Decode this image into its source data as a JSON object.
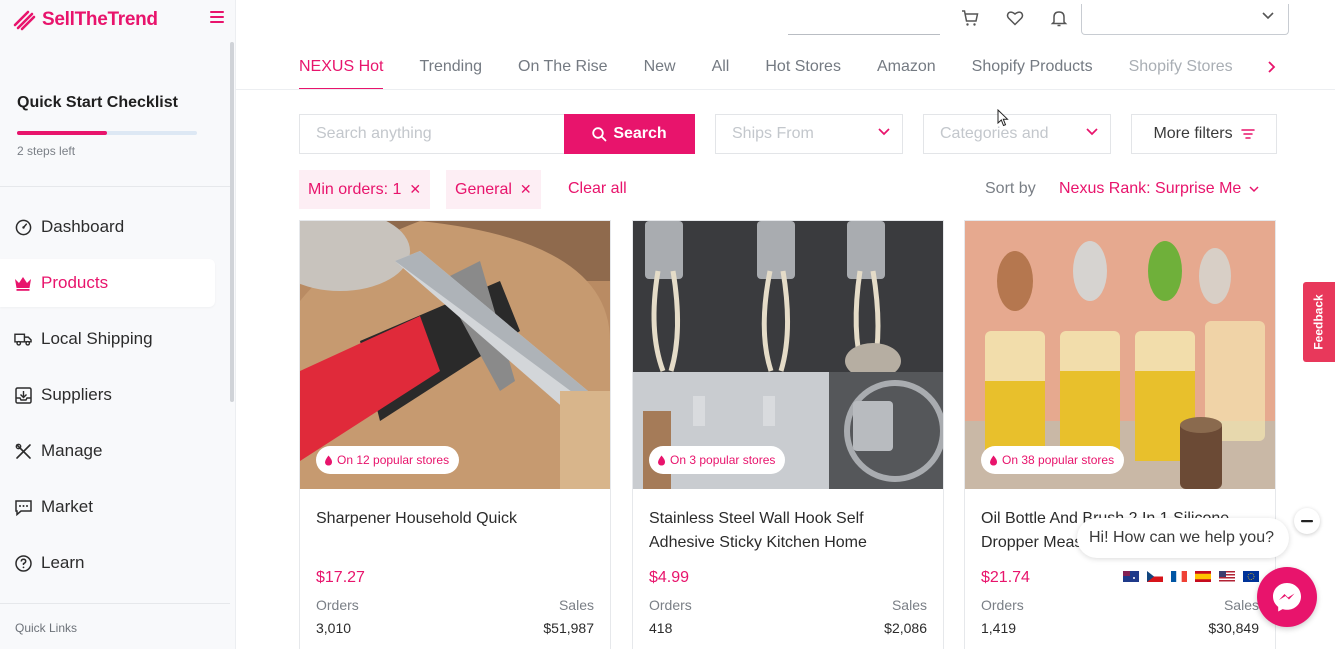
{
  "brand": {
    "name": "SellTheTrend",
    "accent": "#e8146c"
  },
  "sidebar": {
    "checklist_title": "Quick Start Checklist",
    "checklist_progress": 0.5,
    "steps_left": "2 steps left",
    "items": [
      {
        "label": "Dashboard",
        "icon": "gauge-icon"
      },
      {
        "label": "Products",
        "icon": "crown-icon",
        "active": true
      },
      {
        "label": "Local Shipping",
        "icon": "truck-icon"
      },
      {
        "label": "Suppliers",
        "icon": "inbox-download-icon"
      },
      {
        "label": "Manage",
        "icon": "tools-icon"
      },
      {
        "label": "Market",
        "icon": "chat-icon"
      },
      {
        "label": "Learn",
        "icon": "help-circle-icon"
      }
    ],
    "quick_links": "Quick Links"
  },
  "tabs": [
    "NEXUS Hot",
    "Trending",
    "On The Rise",
    "New",
    "All",
    "Hot Stores",
    "Amazon",
    "Shopify Products",
    "Shopify Stores"
  ],
  "search": {
    "placeholder": "Search anything",
    "button": "Search",
    "ships_from": "Ships From",
    "categories": "Categories and",
    "more_filters": "More filters"
  },
  "chips": [
    {
      "label": "Min orders: 1"
    },
    {
      "label": "General"
    }
  ],
  "clear_all": "Clear all",
  "sort": {
    "label": "Sort by",
    "value": "Nexus Rank: Surprise Me"
  },
  "products": [
    {
      "badge": "On 12 popular stores",
      "title": "Sharpener Household Quick",
      "price": "$17.27",
      "orders_label": "Orders",
      "orders": "3,010",
      "sales_label": "Sales",
      "sales": "$51,987"
    },
    {
      "badge": "On 3 popular stores",
      "title": "Stainless Steel Wall Hook Self Adhesive Sticky Kitchen Home",
      "price": "$4.99",
      "orders_label": "Orders",
      "orders": "418",
      "sales_label": "Sales",
      "sales": "$2,086"
    },
    {
      "badge": "On 38 popular stores",
      "title": "Oil Bottle And Brush 2 In 1 Silicone Dropper Measuring",
      "price": "$21.74",
      "orders_label": "Orders",
      "orders": "1,419",
      "sales_label": "Sales",
      "sales": "$30,849",
      "flags": [
        "AU",
        "CZ",
        "FR",
        "ES",
        "US",
        "EU"
      ]
    }
  ],
  "feedback": "Feedback",
  "chat": {
    "greeting": "Hi! How can we help you?"
  }
}
